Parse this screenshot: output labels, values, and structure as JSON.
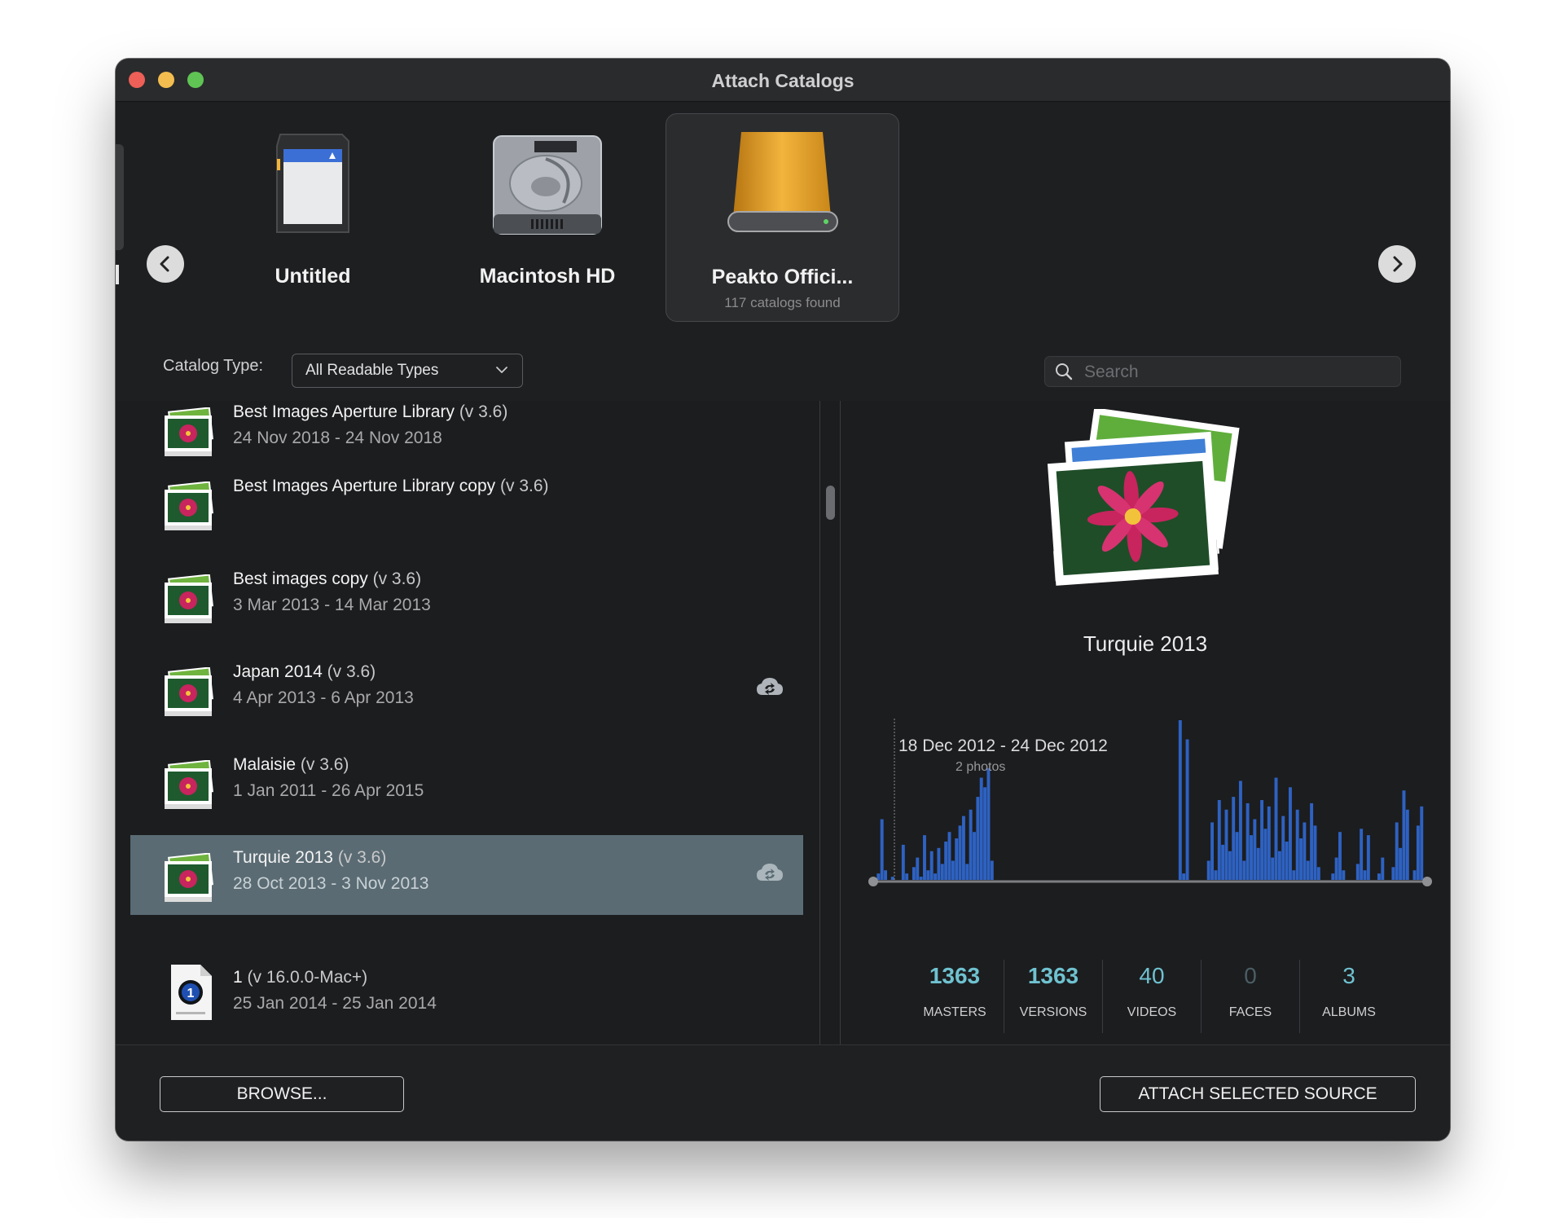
{
  "window": {
    "title": "Attach Catalogs"
  },
  "colors": {
    "accent": "#6fc2d0",
    "selection": "#5a6b73",
    "chart_bar": "#2e62c2",
    "background": "#1e1f21"
  },
  "volumes": [
    {
      "name": "Untitled",
      "subtitle": "",
      "icon": "sd-card-icon"
    },
    {
      "name": "Macintosh HD",
      "subtitle": "",
      "icon": "hard-drive-icon"
    },
    {
      "name": "Peakto Offici...",
      "subtitle": "117 catalogs found",
      "icon": "external-drive-icon",
      "selected": true
    }
  ],
  "filter": {
    "label": "Catalog Type:",
    "value": "All Readable Types",
    "search_placeholder": "Search"
  },
  "catalogs": [
    {
      "name": "Best Images Aperture Library",
      "version": "(v 3.6)",
      "dates": "24 Nov 2018 - 24 Nov 2018",
      "icon": "photos-library-icon",
      "cloud": false
    },
    {
      "name": "Best Images Aperture Library copy",
      "version": "(v 3.6)",
      "dates": "",
      "icon": "photos-library-icon",
      "cloud": false
    },
    {
      "name": "Best images copy",
      "version": "(v 3.6)",
      "dates": "3 Mar 2013 - 14 Mar 2013",
      "icon": "photos-library-icon",
      "cloud": false
    },
    {
      "name": "Japan 2014",
      "version": "(v 3.6)",
      "dates": "4 Apr 2013 - 6 Apr 2013",
      "icon": "photos-library-icon",
      "cloud": true
    },
    {
      "name": "Malaisie",
      "version": "(v 3.6)",
      "dates": "1 Jan 2011 - 26 Apr 2015",
      "icon": "photos-library-icon",
      "cloud": false
    },
    {
      "name": "Turquie 2013",
      "version": "(v 3.6)",
      "dates": "28 Oct 2013 - 3 Nov 2013",
      "icon": "photos-library-icon",
      "cloud": true,
      "selected": true
    },
    {
      "name": "1",
      "version": "(v 16.0.0-Mac+)",
      "dates": "25 Jan 2014 - 25 Jan 2014",
      "icon": "capture-one-catalog-icon",
      "cloud": false
    }
  ],
  "detail": {
    "name": "Turquie 2013",
    "tooltip": {
      "range": "18 Dec 2012 - 24 Dec 2012",
      "count": "2 photos"
    },
    "stats": [
      {
        "value": "1363",
        "label": "MASTERS"
      },
      {
        "value": "1363",
        "label": "VERSIONS"
      },
      {
        "value": "40",
        "label": "VIDEOS"
      },
      {
        "value": "0",
        "label": "FACES"
      },
      {
        "value": "3",
        "label": "ALBUMS"
      }
    ]
  },
  "chart_data": {
    "type": "area",
    "title": "",
    "xlabel": "",
    "ylabel": "",
    "grid": false,
    "series": [
      {
        "values": [
          0,
          4,
          38,
          6,
          0,
          2,
          0,
          0,
          22,
          4,
          0,
          8,
          14,
          2,
          28,
          6,
          18,
          4,
          20,
          10,
          24,
          30,
          12,
          26,
          34,
          40,
          10,
          44,
          30,
          52,
          64,
          58,
          70,
          12,
          0,
          0,
          0,
          0,
          0,
          0,
          0,
          0,
          0,
          0,
          0,
          0,
          0,
          0,
          0,
          0,
          0,
          0,
          0,
          0,
          0,
          0,
          0,
          0,
          0,
          0,
          0,
          0,
          0,
          0,
          0,
          0,
          0,
          0,
          0,
          0,
          0,
          0,
          0,
          0,
          0,
          0,
          0,
          0,
          0,
          0,
          0,
          0,
          0,
          0,
          0,
          0,
          100,
          4,
          88,
          0,
          0,
          0,
          0,
          0,
          12,
          36,
          6,
          50,
          22,
          44,
          18,
          52,
          30,
          62,
          12,
          48,
          28,
          38,
          20,
          50,
          32,
          46,
          14,
          64,
          18,
          40,
          24,
          58,
          6,
          44,
          26,
          36,
          12,
          48,
          34,
          8,
          0,
          0,
          0,
          4,
          14,
          30,
          6,
          0,
          0,
          0,
          10,
          32,
          6,
          28,
          0,
          0,
          4,
          14,
          0,
          0,
          8,
          36,
          20,
          56,
          44,
          0,
          6,
          34,
          46,
          0
        ]
      }
    ]
  },
  "footer": {
    "browse_label": "BROWSE...",
    "attach_label": "ATTACH SELECTED SOURCE"
  }
}
